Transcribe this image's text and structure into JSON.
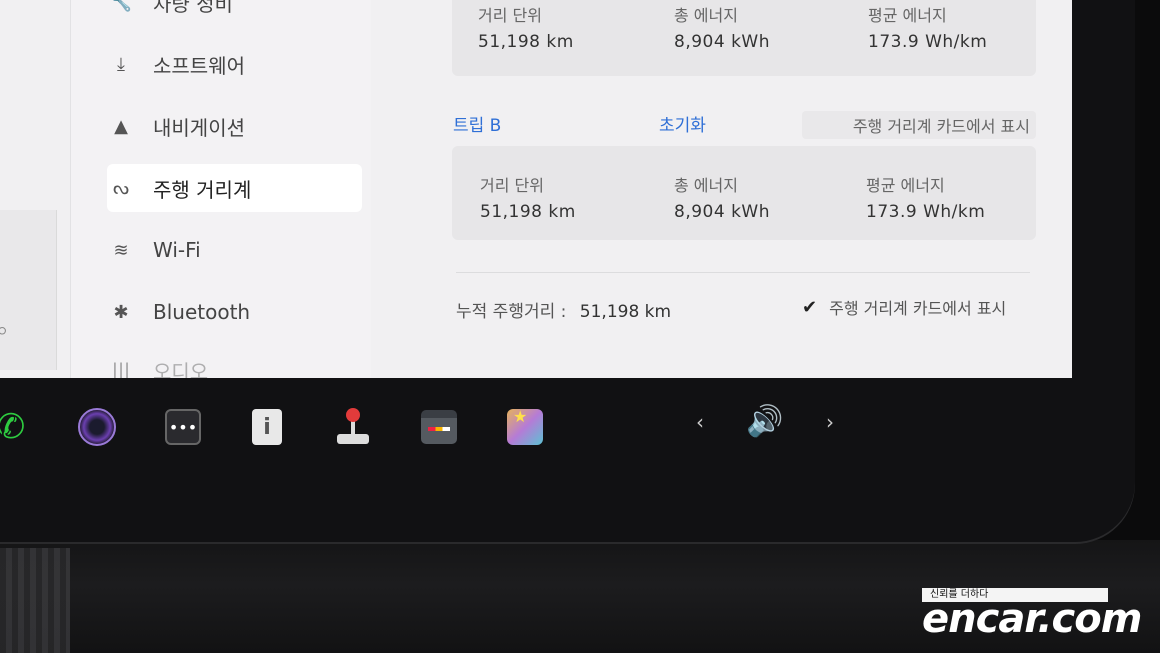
{
  "sidebar": {
    "items": [
      {
        "label": "차량 정비",
        "icon": "wrench-icon"
      },
      {
        "label": "소프트웨어",
        "icon": "download-icon"
      },
      {
        "label": "내비게이션",
        "icon": "navigation-arrow-icon"
      },
      {
        "label": "주행 거리계",
        "icon": "trip-route-icon",
        "active": true
      },
      {
        "label": "Wi-Fi",
        "icon": "wifi-icon"
      },
      {
        "label": "Bluetooth",
        "icon": "bluetooth-icon"
      },
      {
        "label": "오디오",
        "icon": "audio-icon"
      }
    ]
  },
  "trip_a": {
    "distance_label": "거리 단위",
    "distance_value": "51,198 km",
    "energy_label": "총 에너지",
    "energy_value": "8,904 kWh",
    "avg_label": "평균 에너지",
    "avg_value": "173.9 Wh/km"
  },
  "trip_b": {
    "title": "트립 B",
    "reset_label": "초기화",
    "show_label": "주행 거리계 카드에서 표시",
    "distance_label": "거리 단위",
    "distance_value": "51,198 km",
    "energy_label": "총 에너지",
    "energy_value": "8,904 kWh",
    "avg_label": "평균 에너지",
    "avg_value": "173.9 Wh/km"
  },
  "odometer": {
    "label": "누적 주행거리 :",
    "value": "51,198 km",
    "show_label": "주행 거리계 카드에서 표시",
    "show_checked": true
  },
  "taskbar": {
    "icons": [
      "phone-icon",
      "camera-icon",
      "more-apps-icon",
      "manual-icon",
      "joystick-icon",
      "calendar-icon",
      "toybox-icon"
    ],
    "prev_arrow": "‹",
    "next_arrow": "›",
    "volume_icon": "volume-icon"
  },
  "watermark": {
    "tagline": "신뢰를 더하다",
    "brand": "encar.com"
  },
  "colors": {
    "accent": "#2f6fd6",
    "screen_bg": "#f1f0f2",
    "phone_green": "#2ecc40"
  }
}
